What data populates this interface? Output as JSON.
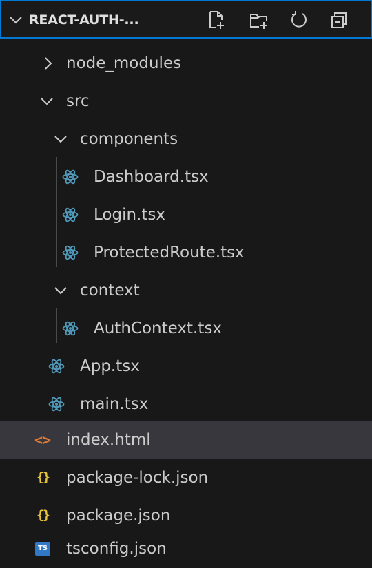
{
  "explorer": {
    "title": "REACT-AUTH-...",
    "actions": [
      {
        "name": "new-file-icon"
      },
      {
        "name": "new-folder-icon"
      },
      {
        "name": "refresh-icon"
      },
      {
        "name": "collapse-all-icon"
      }
    ]
  },
  "tree": [
    {
      "label": "node_modules",
      "kind": "folder",
      "expanded": false
    },
    {
      "label": "src",
      "kind": "folder",
      "expanded": true
    },
    {
      "label": "components",
      "kind": "folder",
      "expanded": true
    },
    {
      "label": "Dashboard.tsx",
      "kind": "react-file"
    },
    {
      "label": "Login.tsx",
      "kind": "react-file"
    },
    {
      "label": "ProtectedRoute.tsx",
      "kind": "react-file"
    },
    {
      "label": "context",
      "kind": "folder",
      "expanded": true
    },
    {
      "label": "AuthContext.tsx",
      "kind": "react-file"
    },
    {
      "label": "App.tsx",
      "kind": "react-file"
    },
    {
      "label": "main.tsx",
      "kind": "react-file"
    },
    {
      "label": "index.html",
      "kind": "html-file",
      "selected": true
    },
    {
      "label": "package-lock.json",
      "kind": "json-file"
    },
    {
      "label": "package.json",
      "kind": "json-file"
    },
    {
      "label": "tsconfig.json",
      "kind": "ts-config-file",
      "badge": "TS"
    }
  ],
  "colors": {
    "focus_border": "#0078d4",
    "selected_row": "#37373d",
    "react_icon": "#519aba",
    "html_icon": "#e37933",
    "json_icon": "#e8c43c",
    "ts_badge": "#3178c6"
  }
}
